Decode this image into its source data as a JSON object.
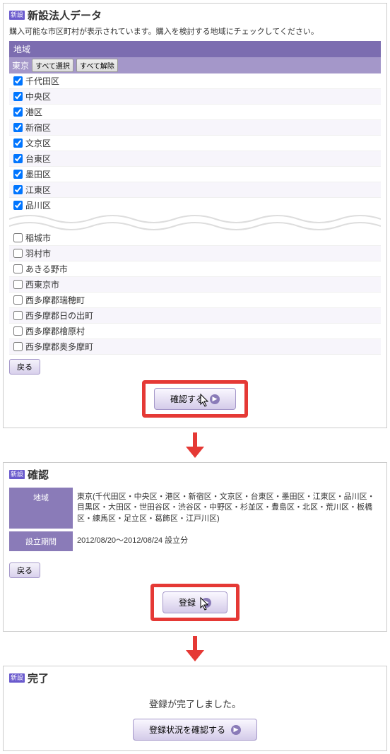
{
  "panel1": {
    "badge": "新設",
    "title": "新設法人データ",
    "subtitle": "購入可能な市区町村が表示されています。購入を検討する地域にチェックしてください。",
    "section_header": "地域",
    "region_label": "東京",
    "select_all": "すべて選択",
    "deselect_all": "すべて解除",
    "cities_top": [
      {
        "name": "千代田区",
        "checked": true
      },
      {
        "name": "中央区",
        "checked": true
      },
      {
        "name": "港区",
        "checked": true
      },
      {
        "name": "新宿区",
        "checked": true
      },
      {
        "name": "文京区",
        "checked": true
      },
      {
        "name": "台東区",
        "checked": true
      },
      {
        "name": "墨田区",
        "checked": true
      },
      {
        "name": "江東区",
        "checked": true
      },
      {
        "name": "品川区",
        "checked": true
      }
    ],
    "cities_bottom": [
      {
        "name": "稲城市",
        "checked": false
      },
      {
        "name": "羽村市",
        "checked": false
      },
      {
        "name": "あきる野市",
        "checked": false
      },
      {
        "name": "西東京市",
        "checked": false
      },
      {
        "name": "西多摩郡瑞穂町",
        "checked": false
      },
      {
        "name": "西多摩郡日の出町",
        "checked": false
      },
      {
        "name": "西多摩郡檜原村",
        "checked": false
      },
      {
        "name": "西多摩郡奥多摩町",
        "checked": false
      }
    ],
    "back": "戻る",
    "confirm": "確認する"
  },
  "panel2": {
    "badge": "新設",
    "title": "確認",
    "row1_label": "地域",
    "row1_value": "東京(千代田区・中央区・港区・新宿区・文京区・台東区・墨田区・江東区・品川区・目黒区・大田区・世田谷区・渋谷区・中野区・杉並区・豊島区・北区・荒川区・板橋区・練馬区・足立区・葛飾区・江戸川区)",
    "row2_label": "設立期間",
    "row2_value": "2012/08/20～2012/08/24 設立分",
    "back": "戻る",
    "register": "登録"
  },
  "panel3": {
    "badge": "新設",
    "title": "完了",
    "message": "登録が完了しました。",
    "check_status": "登録状況を確認する"
  }
}
